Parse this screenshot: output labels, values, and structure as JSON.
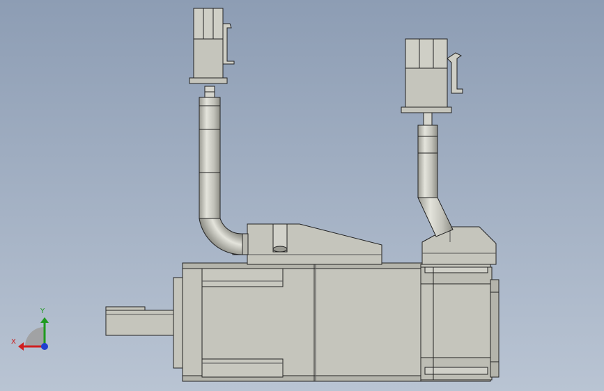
{
  "viewport": {
    "background_top": "#8d9db4",
    "background_bottom": "#b9c4d3"
  },
  "model": {
    "fill": "#c5c5bc",
    "fill_shade": "#b4b4ab",
    "edge": "#222222",
    "components": [
      "motor-body",
      "output-shaft",
      "encoder-housing",
      "cable-gland-left",
      "cable-gland-right",
      "power-cable",
      "encoder-cable",
      "power-connector",
      "encoder-connector"
    ]
  },
  "triad": {
    "x_label": "X",
    "y_label": "Y",
    "x_color": "#d01f1f",
    "y_color": "#1f9a1f",
    "z_color": "#1f3fd0"
  }
}
